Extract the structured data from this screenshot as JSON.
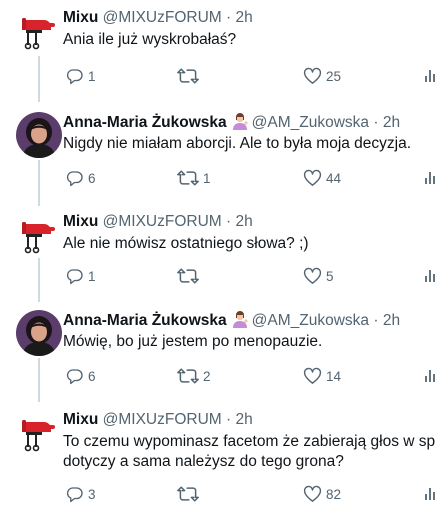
{
  "tweets": [
    {
      "name": "Mixu",
      "handle": "@MIXUzFORUM",
      "dot": "·",
      "time": "2h",
      "lines": [
        "Ania ile już wyskrobałaś?"
      ],
      "replies": "1",
      "retweets": "",
      "likes": "25",
      "avatar": "mixer-icon"
    },
    {
      "name": "Anna-Maria Żukowska",
      "handle": "@AM_Zukowska",
      "dot": "·",
      "time": "2h",
      "lines": [
        "Nigdy nie miałam aborcji. Ale to była moja decyzja."
      ],
      "replies": "6",
      "retweets": "1",
      "likes": "44",
      "avatar": "profile-photo"
    },
    {
      "name": "Mixu",
      "handle": "@MIXUzFORUM",
      "dot": "·",
      "time": "2h",
      "lines": [
        "Ale nie mówisz ostatniego słowa? ;)"
      ],
      "replies": "1",
      "retweets": "",
      "likes": "5",
      "avatar": "mixer-icon"
    },
    {
      "name": "Anna-Maria Żukowska",
      "handle": "@AM_Zukowska",
      "dot": "·",
      "time": "2h",
      "lines": [
        "Mówię, bo już jestem po menopauzie."
      ],
      "replies": "6",
      "retweets": "2",
      "likes": "14",
      "avatar": "profile-photo"
    },
    {
      "name": "Mixu",
      "handle": "@MIXUzFORUM",
      "dot": "·",
      "time": "2h",
      "lines": [
        "To czemu wypominasz facetom że zabierają głos w sp",
        "dotyczy a sama należysz do tego grona?"
      ],
      "replies": "3",
      "retweets": "",
      "likes": "82",
      "avatar": "mixer-icon"
    }
  ],
  "colors": {
    "text": "#0f1419",
    "secondary": "#536471",
    "thread_line": "#cfd9de",
    "mixer_red": "#d8232a"
  }
}
